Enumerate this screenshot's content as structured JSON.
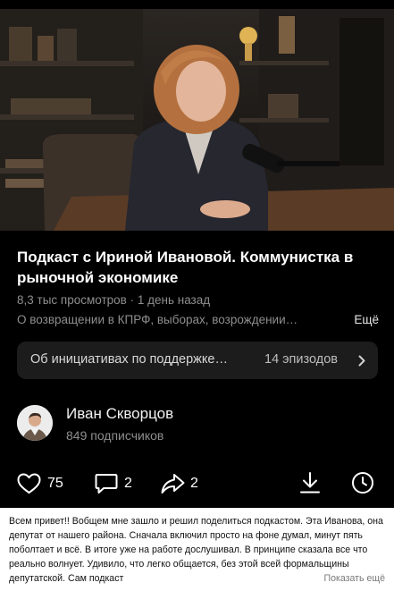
{
  "video": {
    "title": "Подкаст с Ириной Ивановой. Коммунистка в рыночной экономике",
    "views": "8,3 тыс просмотров",
    "separator": " · ",
    "date": "1 день назад",
    "description": "О возвращении в КПРФ, выборах, возрождении…",
    "more_label": "Ещё"
  },
  "playlist": {
    "title": "Об инициативах по поддержке…",
    "count": "14 эпизодов"
  },
  "channel": {
    "name": "Иван Скворцов",
    "subscribers": "849 подписчиков"
  },
  "actions": {
    "likes": "75",
    "comments": "2",
    "shares": "2"
  },
  "comment": {
    "text": "Всем привет!! Вобщем мне зашло и решил поделиться подкастом. Эта Иванова, она депутат от нашего района. Сначала включил просто на фоне думал, минут пять поболтает и всё. В итоге уже на работе дослушивал. В принципе сказала все что реально волнует. Удивило, что легко общается, без этой всей формальщины депутатской. Сам подкаст",
    "show_more": "Показать ещё"
  },
  "icons": {
    "like": "heart-icon",
    "comments": "comment-bubble-icon",
    "share": "share-arrow-icon",
    "download": "download-icon",
    "watch_later": "clock-icon",
    "playlist_open": "chevron-right-icon"
  }
}
